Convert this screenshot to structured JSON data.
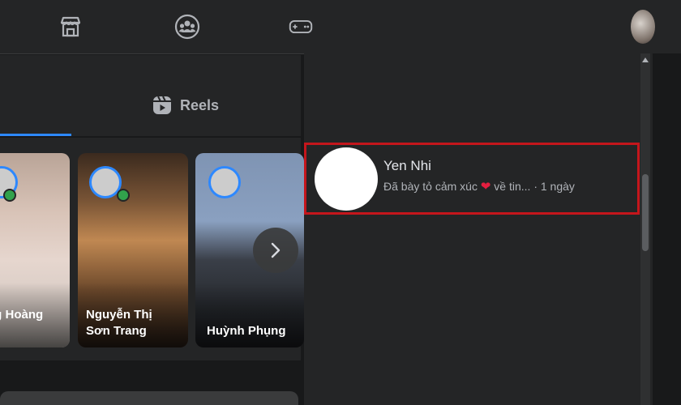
{
  "topbar": {
    "nav_icons": [
      "marketplace-icon",
      "groups-icon",
      "gaming-icon"
    ]
  },
  "feed": {
    "tabs": {
      "reels_label": "Reels"
    },
    "stories": [
      {
        "name": "ng Hoàng\nh"
      },
      {
        "name": "Nguyễn Thị\nSơn Trang"
      },
      {
        "name": "Huỳnh Phụng"
      }
    ]
  },
  "notification": {
    "name": "Yen Nhi",
    "text_before": "Đã bày tỏ cảm xúc",
    "text_after": "về tin...",
    "time": "· 1 ngày",
    "reaction_icon": "heart-icon",
    "highlight_color": "#c4161c"
  },
  "colors": {
    "accent": "#2d88ff",
    "online": "#31a24c",
    "background": "#18191a",
    "surface": "#242526"
  }
}
